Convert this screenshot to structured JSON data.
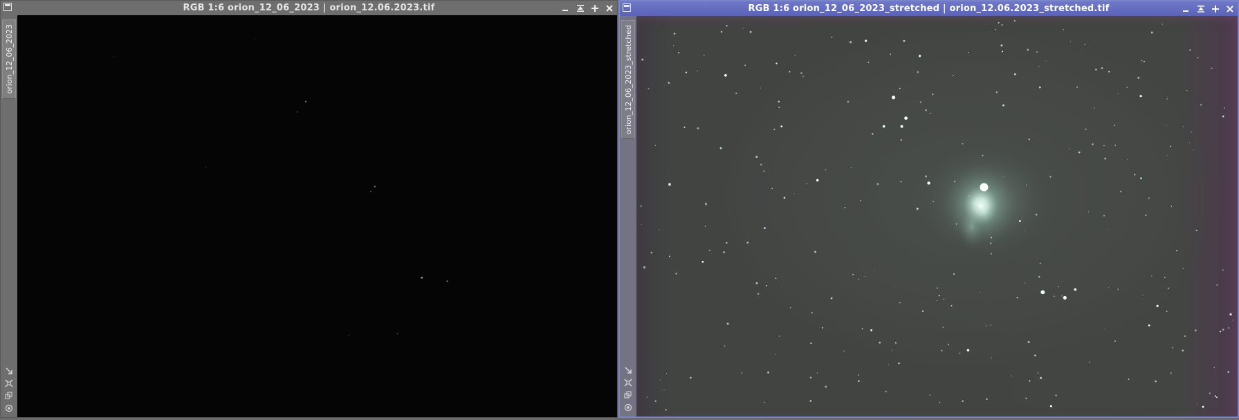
{
  "windows": [
    {
      "title": "RGB 1:6 orion_12_06_2023 | orion_12.06.2023.tif",
      "tab_label": "orion_12_06_2023"
    },
    {
      "title": "RGB 1:6 orion_12_06_2023_stretched | orion_12.06.2023_stretched.tif",
      "tab_label": "orion_12_06_2023_stretched"
    }
  ],
  "icons": {
    "window_menu": "window-menu-icon",
    "minimize": "minimize-icon",
    "shade": "shade-icon",
    "maximize": "maximize-icon",
    "close": "close-icon",
    "tools": [
      "zoom-arrow-icon",
      "fit-view-icon",
      "clone-icon",
      "identify-icon"
    ]
  },
  "colors": {
    "active_titlebar": "#6f78c8",
    "inactive_titlebar": "#6e6e6e",
    "raw_background": "#050505",
    "stretched_background": "#434542",
    "nebula_core": "#e8fff4"
  }
}
